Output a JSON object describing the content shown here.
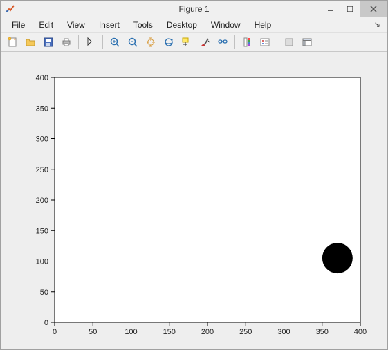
{
  "window": {
    "title": "Figure 1"
  },
  "menu": {
    "items": [
      "File",
      "Edit",
      "View",
      "Insert",
      "Tools",
      "Desktop",
      "Window",
      "Help"
    ]
  },
  "toolbar": {
    "buttons": [
      "new-figure",
      "open-file",
      "save-figure",
      "print-figure",
      "|",
      "edit-plot",
      "|",
      "zoom-in",
      "zoom-out",
      "pan",
      "rotate-3d",
      "data-cursor",
      "brush",
      "link-plot",
      "|",
      "insert-colorbar",
      "insert-legend",
      "|",
      "hide-plot-tools",
      "show-plot-tools"
    ]
  },
  "chart_data": {
    "type": "scatter",
    "x": [
      370
    ],
    "y": [
      105
    ],
    "marker": {
      "size": 22,
      "color": "#000000",
      "shape": "circle"
    },
    "xlim": [
      0,
      400
    ],
    "ylim": [
      0,
      400
    ],
    "xticks": [
      0,
      50,
      100,
      150,
      200,
      250,
      300,
      350,
      400
    ],
    "yticks": [
      0,
      50,
      100,
      150,
      200,
      250,
      300,
      350,
      400
    ],
    "title": "",
    "xlabel": "",
    "ylabel": ""
  }
}
